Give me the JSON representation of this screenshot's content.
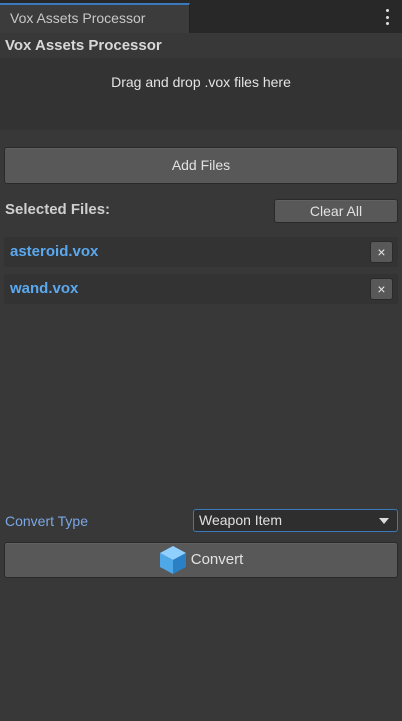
{
  "window": {
    "tab_title": "Vox Assets Processor",
    "menu_icon": "more-vertical-icon"
  },
  "panel": {
    "title": "Vox Assets Processor",
    "dropzone_text": "Drag and drop .vox files here",
    "add_files_label": "Add Files",
    "selected_files_label": "Selected Files:",
    "clear_all_label": "Clear All",
    "files": [
      {
        "name": "asteroid.vox",
        "remove_label": "×"
      },
      {
        "name": "wand.vox",
        "remove_label": "×"
      }
    ],
    "convert_type_label": "Convert Type",
    "convert_type_value": "Weapon Item",
    "convert_label": "Convert",
    "convert_icon": "cube-icon"
  },
  "colors": {
    "accent": "#3a79bb",
    "file_name": "#5aa9f0",
    "label_blue": "#7aa7e6",
    "background": "#383838"
  }
}
